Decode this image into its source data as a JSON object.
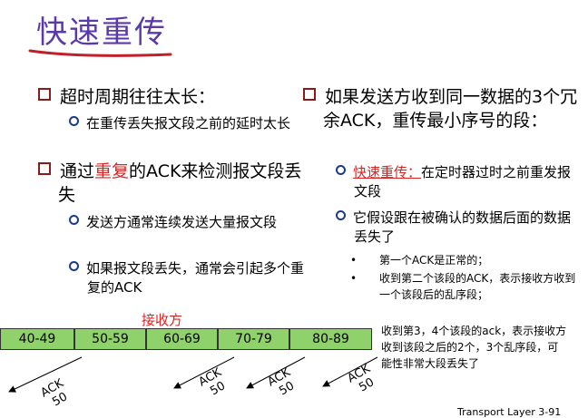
{
  "title": "快速重传",
  "left": {
    "b1": "超时周期往往太长：",
    "b1_sub": "在重传丢失报文段之前的延时太长",
    "b2_a": "通过",
    "b2_red": "重复",
    "b2_b": "的ACK来检测报文段丢失",
    "b2_sub1": "发送方通常连续发送大量报文段",
    "b2_sub2": "如果报文段丢失，通常会引起多个重复的ACK"
  },
  "right": {
    "b1": "如果发送方收到同一数据的3个冗余ACK，重传最小序号的段：",
    "sub1_red": "快速重传：",
    "sub1_rest": "在定时器过时之前重发报文段",
    "sub2": "它假设跟在被确认的数据后面的数据丢失了",
    "dot1": "第一个ACK是正常的；",
    "dot2": "收到第二个该段的ACK，表示接收方收到一个该段后的乱序段；",
    "dot3": "收到第3，4个该段的ack，表示接收方收到该段之后的2个，3个乱序段，可能性非常大段丢失了"
  },
  "receiver_label": "接收方",
  "segments": [
    "40-49",
    "50-59",
    "60-69",
    "70-79",
    "80-89"
  ],
  "ack_label": "ACK",
  "ack_value": "50",
  "footer": "Transport Layer   3-91"
}
